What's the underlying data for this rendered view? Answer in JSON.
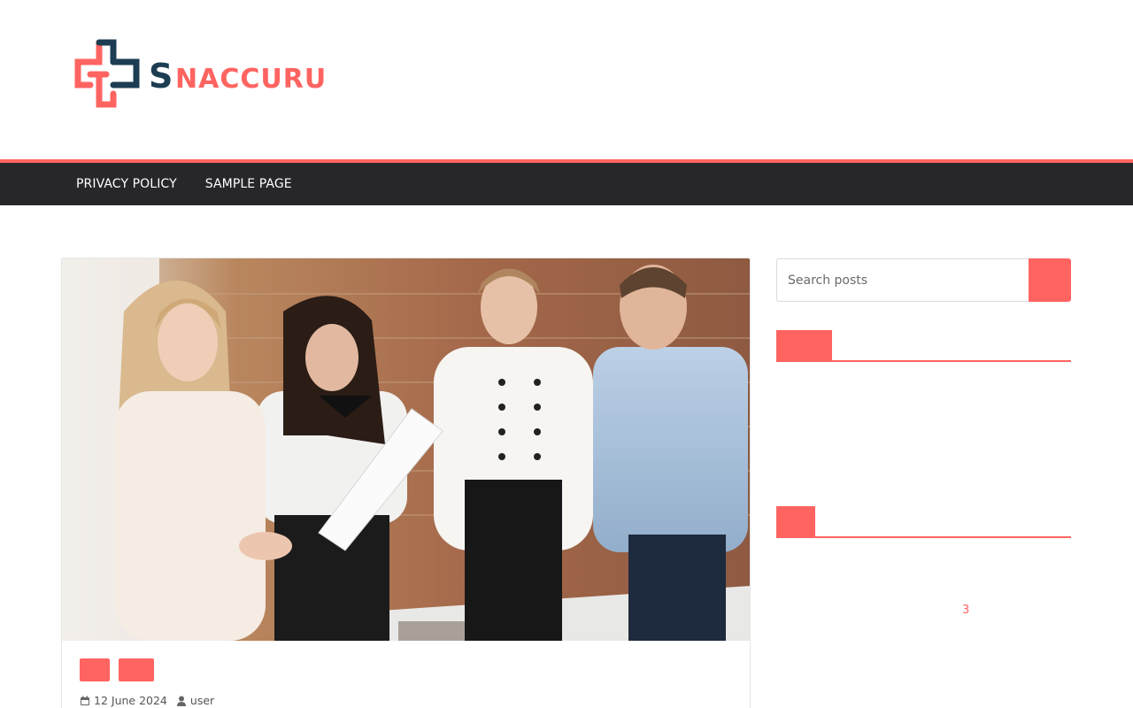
{
  "header": {
    "logo_text": "SNACCURU",
    "logo_colors": {
      "primary": "#ff6461",
      "secondary": "#1c3d52"
    }
  },
  "nav": {
    "items": [
      {
        "label": "PRIVACY POLICY"
      },
      {
        "label": "SAMPLE PAGE"
      }
    ],
    "accent": "#ff6461",
    "background": "#27272a"
  },
  "post": {
    "image_alt_icon": "photo-icon",
    "date": "12 June 2024",
    "author": "user",
    "categories": [
      {
        "label": ""
      },
      {
        "label": ""
      }
    ]
  },
  "sidebar": {
    "search": {
      "placeholder": "Search posts",
      "button_icon": "search-icon"
    },
    "widgets": [
      {
        "title": ""
      },
      {
        "title": "",
        "link_text": "3"
      }
    ]
  }
}
